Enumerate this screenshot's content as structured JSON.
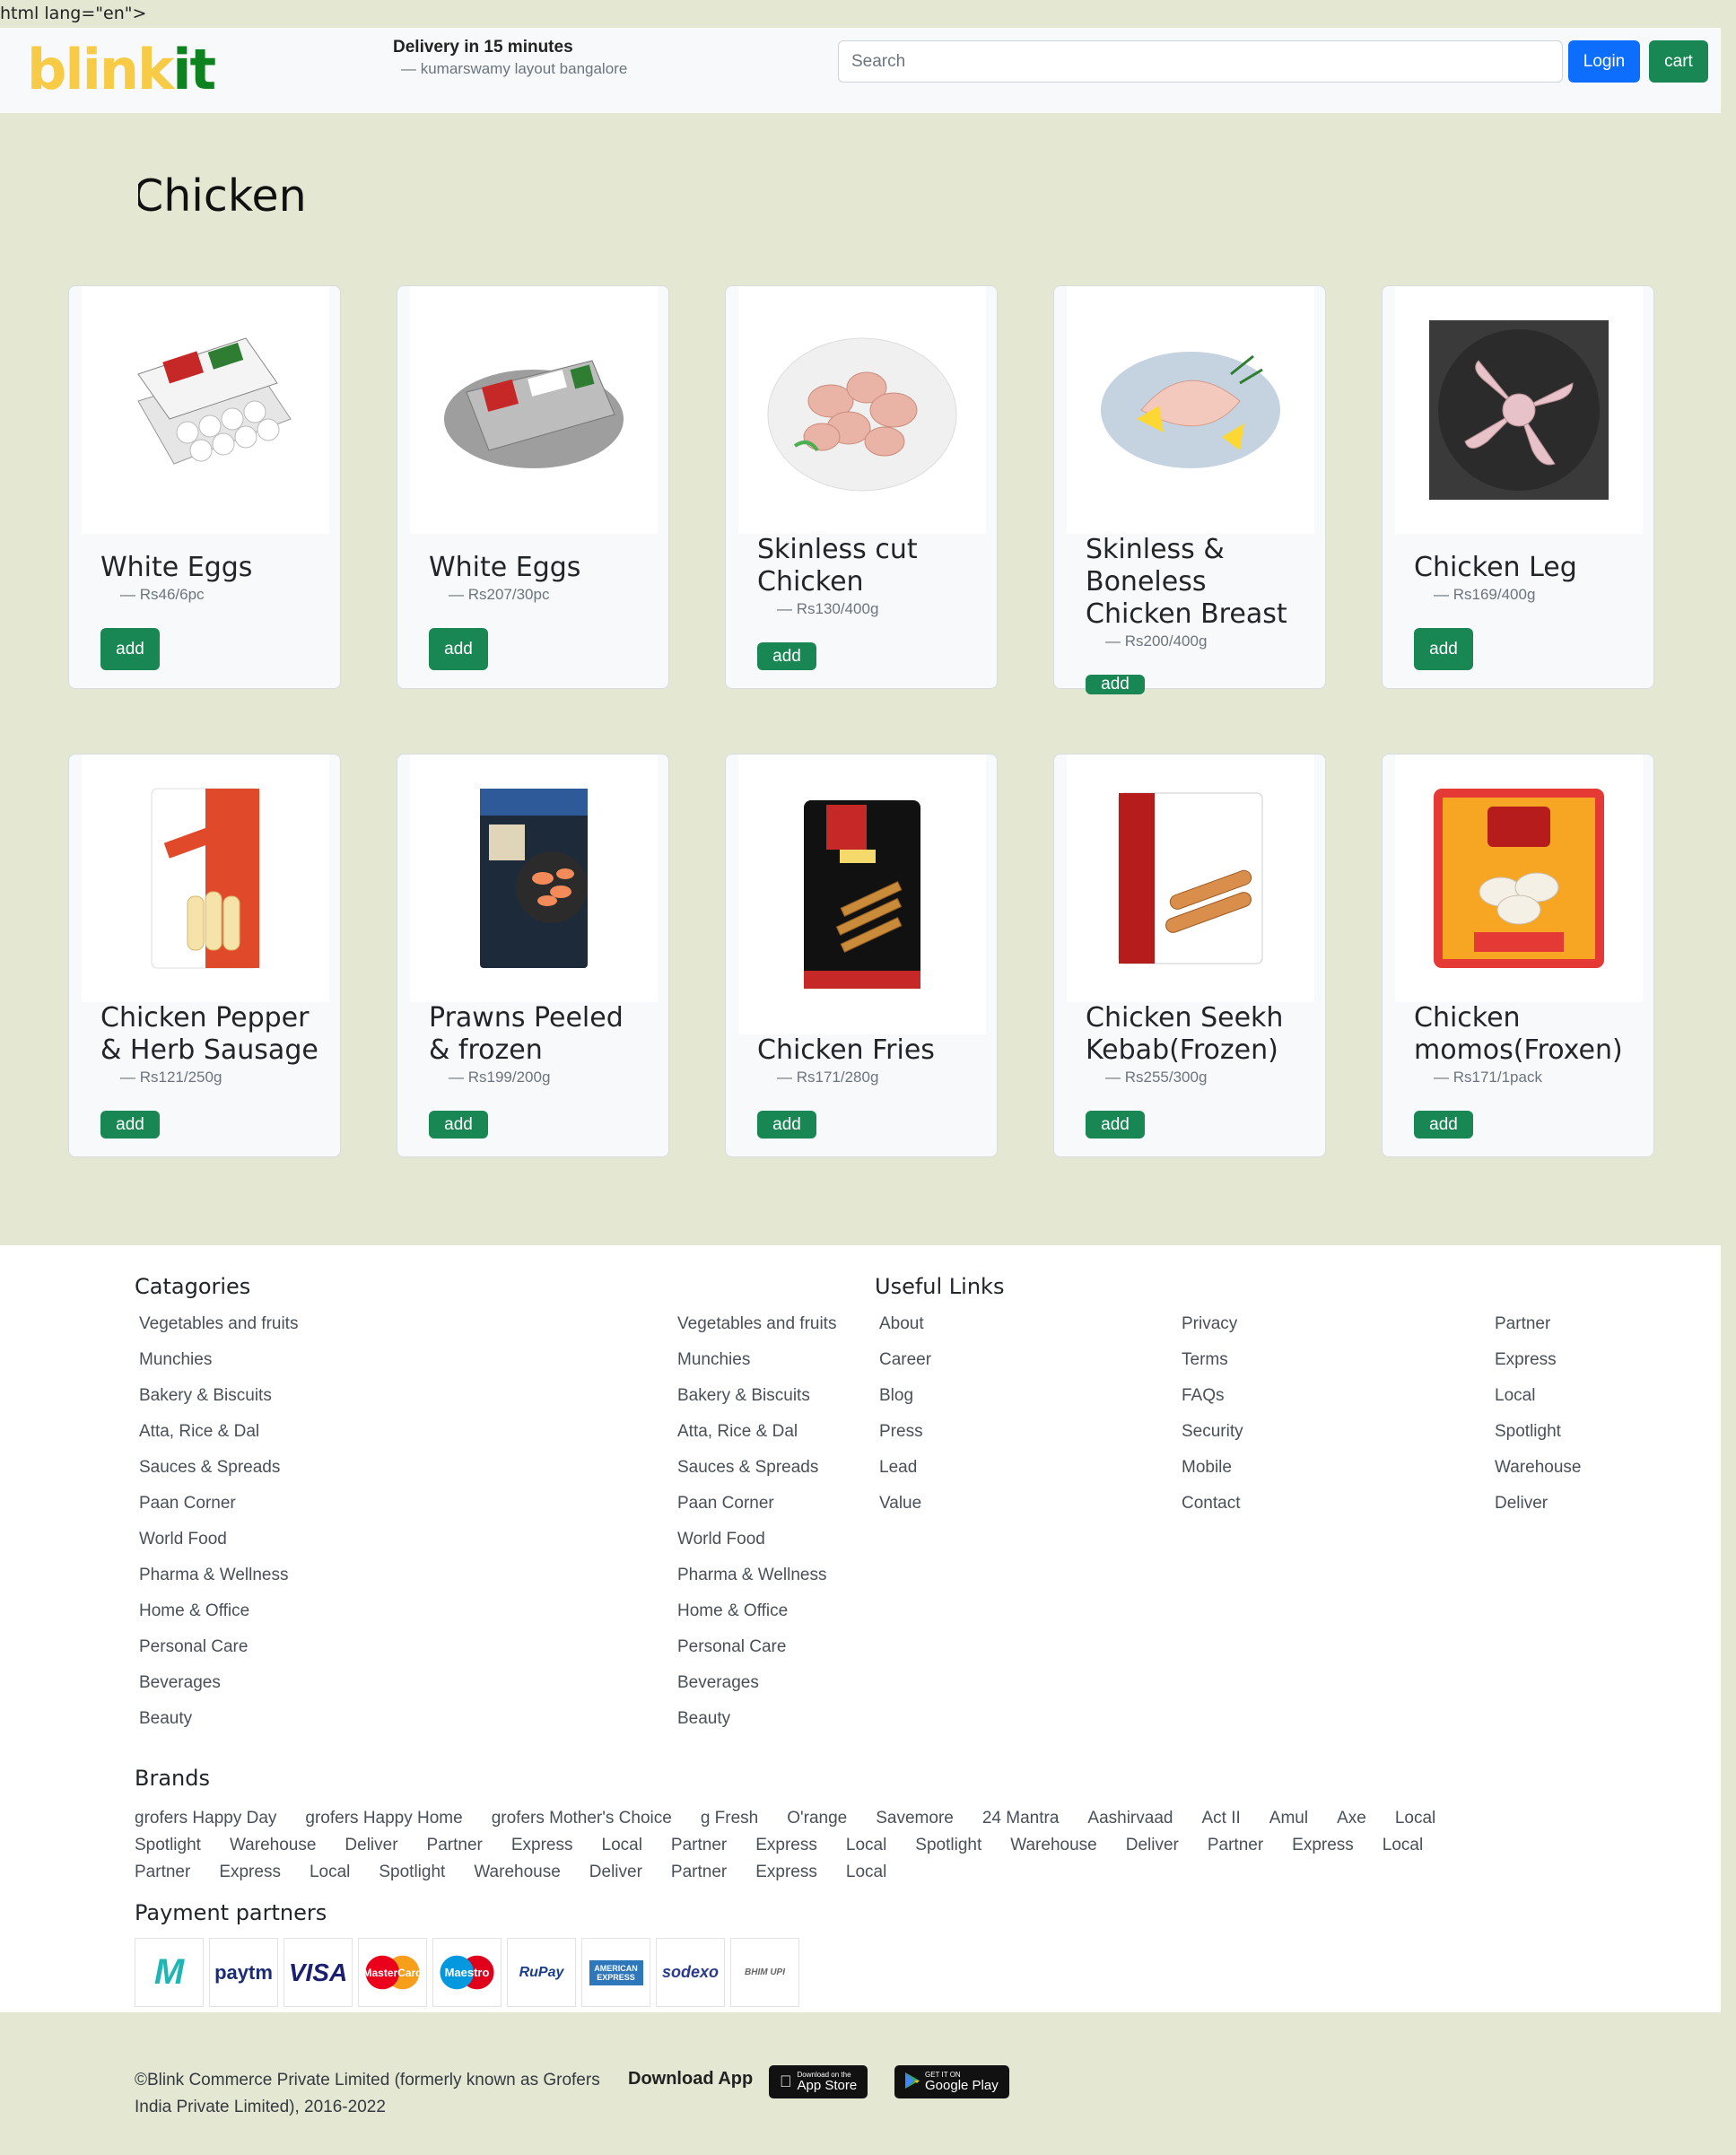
{
  "stray_text": "html lang=\"en\">",
  "header": {
    "logo_part1": "blink",
    "logo_part2": "it",
    "delivery_title": "Delivery in 15 minutes",
    "delivery_address": "— kumarswamy layout bangalore",
    "search_placeholder": "Search",
    "login_label": "Login",
    "cart_label": "cart"
  },
  "page_title": "Chicken",
  "add_label": "add",
  "products": [
    {
      "name": "White Eggs",
      "price": "Rs46/6pc",
      "image": "egg-tray"
    },
    {
      "name": "White Eggs",
      "price": "Rs207/30pc",
      "image": "egg-tray-large"
    },
    {
      "name": "Skinless cut Chicken",
      "price": "Rs130/400g",
      "image": "chicken-pieces"
    },
    {
      "name": "Skinless & Boneless Chicken Breast",
      "price": "Rs200/400g",
      "image": "chicken-breast"
    },
    {
      "name": "Chicken Leg",
      "price": "Rs169/400g",
      "image": "chicken-leg"
    },
    {
      "name": "Chicken Pepper & Herb Sausage",
      "price": "Rs121/250g",
      "image": "sausage-pack"
    },
    {
      "name": "Prawns Peeled & frozen",
      "price": "Rs199/200g",
      "image": "prawns-pack"
    },
    {
      "name": "Chicken Fries",
      "price": "Rs171/280g",
      "image": "fries-pack"
    },
    {
      "name": "Chicken Seekh Kebab(Frozen)",
      "price": "Rs255/300g",
      "image": "kebab-pack"
    },
    {
      "name": "Chicken momos(Froxen)",
      "price": "Rs171/1pack",
      "image": "momos-pack"
    }
  ],
  "footer": {
    "categories_heading": "Catagories",
    "useful_links_heading": "Useful Links",
    "categories": [
      "Vegetables and fruits",
      "Munchies",
      "Bakery & Biscuits",
      "Atta, Rice & Dal",
      "Sauces & Spreads",
      "Paan Corner",
      "World Food",
      "Pharma & Wellness",
      "Home & Office",
      "Personal Care",
      "Beverages",
      "Beauty"
    ],
    "links_col1": [
      "About",
      "Career",
      "Blog",
      "Press",
      "Lead",
      "Value"
    ],
    "links_col2": [
      "Privacy",
      "Terms",
      "FAQs",
      "Security",
      "Mobile",
      "Contact"
    ],
    "links_col3": [
      "Partner",
      "Express",
      "Local",
      "Spotlight",
      "Warehouse",
      "Deliver"
    ],
    "brands_heading": "Brands",
    "brands": [
      "grofers Happy Day",
      "grofers Happy Home",
      "grofers Mother's Choice",
      "g Fresh",
      "O'range",
      "Savemore",
      "24 Mantra",
      "Aashirvaad",
      "Act II",
      "Amul",
      "Axe",
      "Local",
      "Spotlight",
      "Warehouse",
      "Deliver",
      "Partner",
      "Express",
      "Local",
      "Partner",
      "Express",
      "Local",
      "Spotlight",
      "Warehouse",
      "Deliver",
      "Partner",
      "Express",
      "Local",
      "Partner",
      "Express",
      "Local",
      "Spotlight",
      "Warehouse",
      "Deliver",
      "Partner",
      "Express",
      "Local"
    ],
    "payment_heading": "Payment partners",
    "payments": [
      "M",
      "paytm",
      "VISA",
      "MasterCard",
      "Maestro",
      "RuPay",
      "AMERICAN EXPRESS",
      "sodexo",
      "BHIM UPI"
    ],
    "copyright": "©Blink Commerce Private Limited (formerly known as Grofers India Private Limited), 2016-2022",
    "download_label": "Download App",
    "appstore_small": "Download on the",
    "appstore_big": "App Store",
    "googleplay_small": "GET IT ON",
    "googleplay_big": "Google Play"
  }
}
